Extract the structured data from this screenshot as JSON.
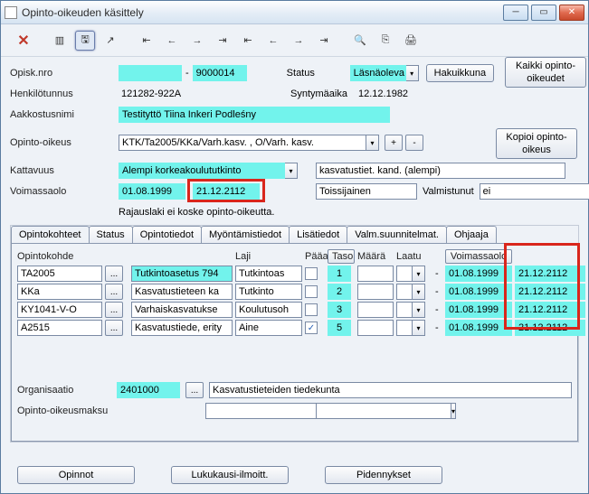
{
  "window": {
    "title": "Opinto-oikeuden käsittely"
  },
  "toolbar": {},
  "labels": {
    "opisk_nro": "Opisk.nro",
    "dash": "-",
    "status": "Status",
    "hakuikkuna": "Hakuikkuna",
    "kaikki_opinto": "Kaikki opinto-oikeudet",
    "henkilotunnus": "Henkilötunnus",
    "syntymaika": "Syntymäaika",
    "aakkostusnimi": "Aakkostusnimi",
    "opinto_oikeus": "Opinto-oikeus",
    "kopioi_opinto": "Kopioi opinto-oikeus",
    "kattavuus": "Kattavuus",
    "voimassaolo": "Voimassaolo",
    "rajauslaki": "Rajauslaki ei koske opinto-oikeutta.",
    "organisaatio": "Organisaatio",
    "opinto_oikeusmaksu": "Opinto-oikeusmaksu",
    "plus": "+",
    "minus": "-",
    "dots": "..."
  },
  "values": {
    "opisk_suffix": "9000014",
    "status": "Läsnäoleva",
    "henkilotunnus": "121282-922A",
    "syntymaika": "12.12.1982",
    "aakkostusnimi": "Testityttö Tiina Inkeri Podleśny",
    "opinto_oikeus": "KTK/Ta2005/KKa/Varh.kasv. , O/Varh. kasv.",
    "kattavuus": "Alempi korkeakoulututkinto",
    "kattavuus2": "kasvatustiet. kand. (alempi)",
    "voim_start": "01.08.1999",
    "voim_end": "21.12.2112",
    "toissijainen": "Toissijainen",
    "valmistunut_lbl": "Valmistunut",
    "valmistunut_val": "ei",
    "organisaatio_code": "2401000",
    "organisaatio_name": "Kasvatustieteiden tiedekunta"
  },
  "tabs": [
    "Opintokohteet",
    "Status",
    "Opintotiedot",
    "Myöntämistiedot",
    "Lisätiedot",
    "Valm.suunnitelmat.",
    "Ohjaaja"
  ],
  "grid": {
    "headers": {
      "opintokohde": "Opintokohde",
      "laji": "Laji",
      "paa": "Pääaine",
      "taso": "Taso",
      "maara": "Määrä",
      "laatu": "Laatu",
      "voim": "Voimassaolo"
    },
    "rows": [
      {
        "code": "TA2005",
        "cyan": true,
        "name": "Tutkintoasetus 794",
        "laji": "Tutkintoas",
        "paa": false,
        "taso": "1",
        "start": "01.08.1999",
        "end": "21.12.2112"
      },
      {
        "code": "KKa",
        "cyan": false,
        "name": "Kasvatustieteen ka",
        "laji": "Tutkinto",
        "paa": false,
        "taso": "2",
        "start": "01.08.1999",
        "end": "21.12.2112"
      },
      {
        "code": "KY1041-V-O",
        "cyan": false,
        "name": "Varhaiskasvatukse",
        "laji": "Koulutusoh",
        "paa": false,
        "taso": "3",
        "start": "01.08.1999",
        "end": "21.12.2112"
      },
      {
        "code": "A2515",
        "cyan": false,
        "name": "Kasvatustiede, erity",
        "laji": "Aine",
        "paa": true,
        "taso": "5",
        "start": "01.08.1999",
        "end": "21.12.2112"
      }
    ]
  },
  "footer": {
    "opinnot": "Opinnot",
    "lukukausi": "Lukukausi-ilmoitt.",
    "pidennykset": "Pidennykset"
  }
}
